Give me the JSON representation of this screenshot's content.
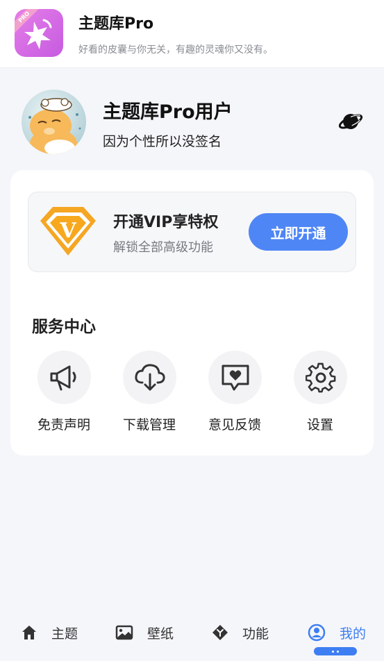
{
  "banner": {
    "app_title": "主题库Pro",
    "app_subtitle": "好看的皮囊与你无关，有趣的灵魂你又没有。",
    "logo_ribbon": "PRO"
  },
  "profile": {
    "username": "主题库Pro用户",
    "signature": "因为个性所以没签名"
  },
  "vip": {
    "title": "开通VIP享特权",
    "subtitle": "解锁全部高级功能",
    "button": "立即开通",
    "badge_letter": "V"
  },
  "services": {
    "title": "服务中心",
    "items": [
      {
        "label": "免责声明",
        "icon": "megaphone-icon"
      },
      {
        "label": "下载管理",
        "icon": "cloud-download-icon"
      },
      {
        "label": "意见反馈",
        "icon": "feedback-heart-icon"
      },
      {
        "label": "设置",
        "icon": "gear-icon"
      }
    ]
  },
  "nav": {
    "items": [
      {
        "label": "主题",
        "icon": "home-icon"
      },
      {
        "label": "壁纸",
        "icon": "image-icon"
      },
      {
        "label": "功能",
        "icon": "diamond-icon"
      },
      {
        "label": "我的",
        "icon": "user-icon",
        "active": true
      }
    ]
  },
  "colors": {
    "accent": "#4f86f5",
    "nav_active": "#3d7ef2",
    "vip_orange": "#f5a623",
    "logo_purple": "#d46be6"
  }
}
